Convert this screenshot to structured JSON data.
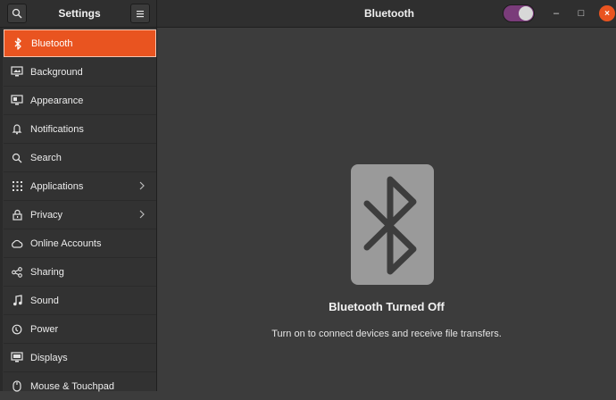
{
  "header": {
    "left_title": "Settings",
    "main_title": "Bluetooth",
    "bluetooth_switch": "off"
  },
  "window_controls": {
    "minimize_glyph": "–",
    "maximize_glyph": "□",
    "close_glyph": "×"
  },
  "sidebar": {
    "items": [
      {
        "label": "Bluetooth",
        "icon": "bluetooth-icon",
        "selected": true
      },
      {
        "label": "Background",
        "icon": "monitor-icon"
      },
      {
        "label": "Appearance",
        "icon": "appearance-icon"
      },
      {
        "label": "Notifications",
        "icon": "bell-icon"
      },
      {
        "label": "Search",
        "icon": "search-icon"
      },
      {
        "label": "Applications",
        "icon": "grid-icon",
        "has_submenu": true
      },
      {
        "label": "Privacy",
        "icon": "lock-icon",
        "has_submenu": true
      },
      {
        "label": "Online Accounts",
        "icon": "cloud-icon"
      },
      {
        "label": "Sharing",
        "icon": "share-icon"
      },
      {
        "label": "Sound",
        "icon": "music-note-icon"
      },
      {
        "label": "Power",
        "icon": "power-icon"
      },
      {
        "label": "Displays",
        "icon": "display-icon"
      },
      {
        "label": "Mouse & Touchpad",
        "icon": "mouse-icon"
      }
    ]
  },
  "main": {
    "status_title": "Bluetooth Turned Off",
    "status_description": "Turn on to connect devices and receive file transfers."
  },
  "colors": {
    "accent": "#e95420",
    "switch_track": "#7a3c7a",
    "background": "#3c3c3c",
    "sidebar": "#323232"
  }
}
